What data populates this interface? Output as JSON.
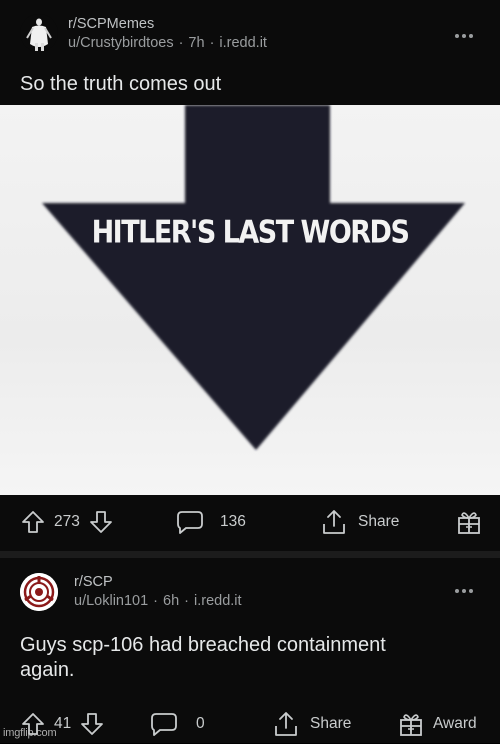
{
  "posts": [
    {
      "subreddit": "r/SCPMemes",
      "user": "u/Crustybirdtoes",
      "age": "7h",
      "domain": "i.redd.it",
      "title": "So the truth comes out",
      "meme_caption": "HITLER'S LAST WORDS",
      "upvotes": "273",
      "comments": "136",
      "share_label": "Share",
      "avatar_icon": "figure-avatar-icon"
    },
    {
      "subreddit": "r/SCP",
      "user": "u/Loklin101",
      "age": "6h",
      "domain": "i.redd.it",
      "title_line1": "Guys scp-106 had breached containment",
      "title_line2": "again.",
      "upvotes": "41",
      "comments": "0",
      "share_label": "Share",
      "award_label": "Award",
      "avatar_icon": "scp-logo-icon"
    }
  ],
  "watermark": "imgflip.com",
  "colors": {
    "background": "#0b0b0b",
    "text": "#d7dadc",
    "arrow": "#1b1f2b",
    "scp_red": "#8b1a1a"
  }
}
